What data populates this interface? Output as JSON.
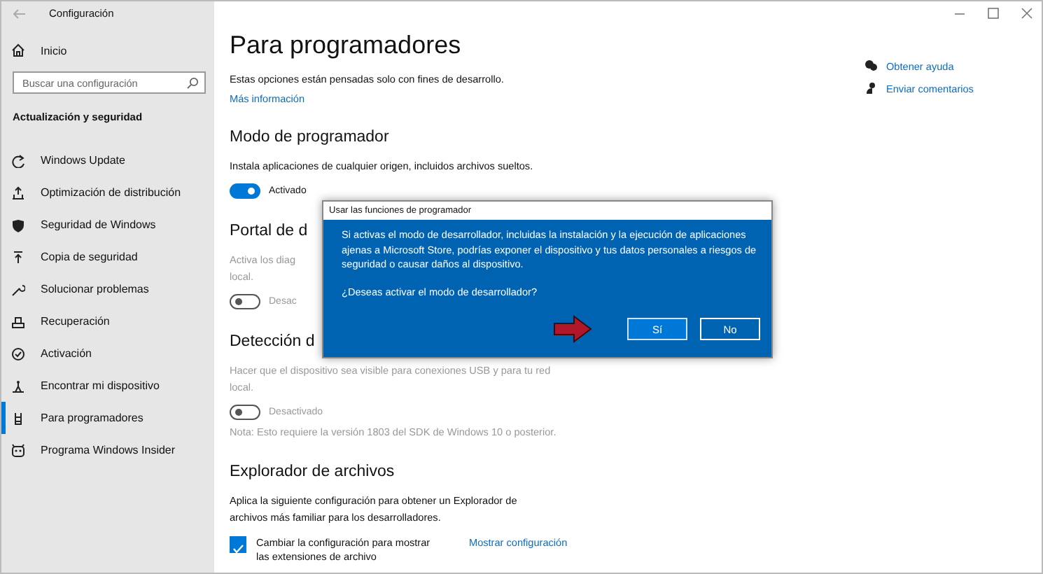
{
  "window": {
    "title": "Configuración"
  },
  "sidebar": {
    "home": "Inicio",
    "search": {
      "placeholder": "Buscar una configuración"
    },
    "section": "Actualización y seguridad",
    "items": [
      {
        "label": "Windows Update",
        "selected": false
      },
      {
        "label": "Optimización de distribución",
        "selected": false
      },
      {
        "label": "Seguridad de Windows",
        "selected": false
      },
      {
        "label": "Copia de seguridad",
        "selected": false
      },
      {
        "label": "Solucionar problemas",
        "selected": false
      },
      {
        "label": "Recuperación",
        "selected": false
      },
      {
        "label": "Activación",
        "selected": false
      },
      {
        "label": "Encontrar mi dispositivo",
        "selected": false
      },
      {
        "label": "Para programadores",
        "selected": true
      },
      {
        "label": "Programa Windows Insider",
        "selected": false
      }
    ]
  },
  "page": {
    "title": "Para programadores",
    "description": "Estas opciones están pensadas solo con fines de desarrollo.",
    "link": "Más información",
    "help_links": [
      "Obtener ayuda",
      "Enviar comentarios"
    ],
    "sections": [
      {
        "heading": "Modo de programador",
        "text_lines": [
          "Instala aplicaciones de cualquier origen, incluidos archivos sueltos."
        ],
        "toggle": {
          "on": true,
          "label": "Activado"
        }
      },
      {
        "heading": "Portal de d",
        "text_lines": [
          "Activa los diag",
          "local."
        ],
        "toggle": {
          "on": false,
          "label": "Desac"
        }
      },
      {
        "heading": "Detección d",
        "text_lines": [
          "Hacer que el dispositivo sea visible para conexiones USB y para tu red",
          "local."
        ],
        "toggle": {
          "on": false,
          "label": "Desactivado"
        },
        "note": "Nota: Esto requiere la versión 1803 del SDK de Windows 10 o posterior."
      },
      {
        "heading": "Explorador de archivos",
        "text_lines": [
          "Aplica la siguiente configuración para obtener un Explorador de",
          "archivos más familiar para los desarrolladores."
        ],
        "checkbox": {
          "checked": true,
          "label": "Cambiar la configuración para mostrar las extensiones de archivo"
        },
        "link": "Mostrar configuración"
      }
    ]
  },
  "dialog": {
    "title": "Usar las funciones de programador",
    "message": "Si activas el modo de desarrollador, incluidas la instalación y la ejecución de aplicaciones ajenas a Microsoft Store, podrías exponer el dispositivo y tus datos personales a riesgos de seguridad o causar daños al dispositivo.",
    "question": "¿Deseas activar el modo de desarrollador?",
    "buttons": [
      {
        "label": "Sí",
        "selected": true
      },
      {
        "label": "No",
        "selected": false
      }
    ]
  }
}
